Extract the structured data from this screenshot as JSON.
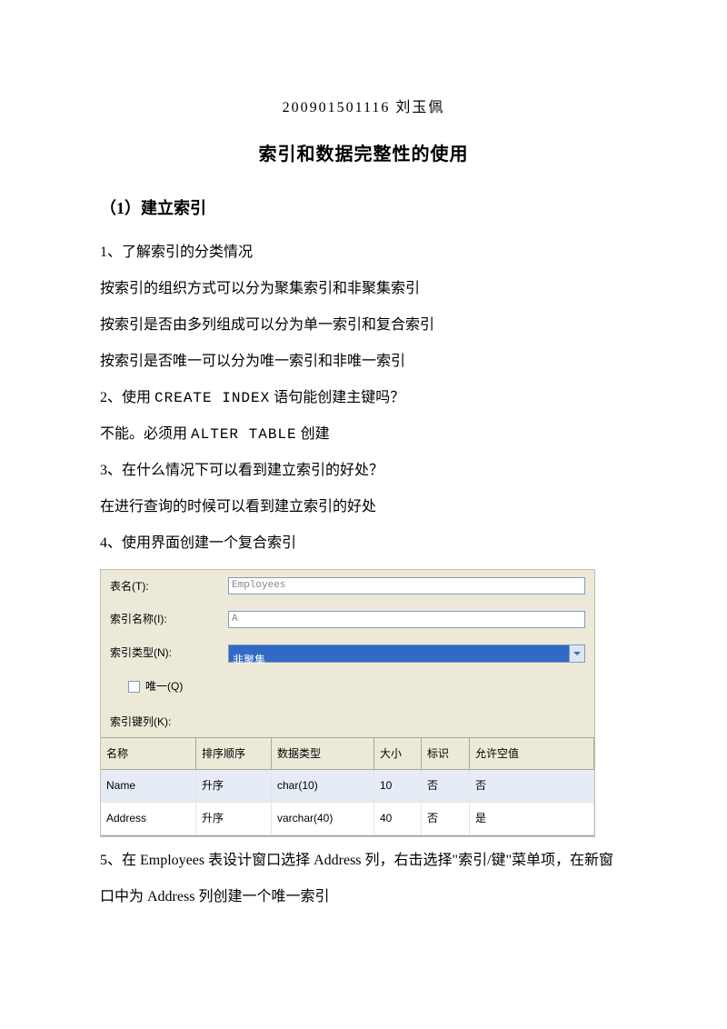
{
  "header": "200901501116 刘玉佩",
  "title": "索引和数据完整性的使用",
  "section1": {
    "heading": "（1）建立索引",
    "p1": "1、了解索引的分类情况",
    "p2": "按索引的组织方式可以分为聚集索引和非聚集索引",
    "p3": "按索引是否由多列组成可以分为单一索引和复合索引",
    "p4": "按索引是否唯一可以分为唯一索引和非唯一索引",
    "p5a": "2、使用 ",
    "p5code": "CREATE INDEX",
    "p5b": " 语句能创建主键吗？",
    "p6a": "不能。必须用 ",
    "p6code": "ALTER TABLE",
    "p6b": " 创建",
    "p7": "3、在什么情况下可以看到建立索引的好处？",
    "p8": "在进行查询的时候可以看到建立索引的好处",
    "p9": "4、使用界面创建一个复合索引",
    "p10": "5、在 Employees 表设计窗口选择 Address 列，右击选择\"索引/键\"菜单项，在新窗口中为 Address 列创建一个唯一索引"
  },
  "form": {
    "labels": {
      "tableName": "表名(T):",
      "indexName": "索引名称(I):",
      "indexType": "索引类型(N):",
      "unique": "唯一(Q)",
      "keyColumns": "索引键列(K):"
    },
    "values": {
      "tableName": "Employees",
      "indexName": "A",
      "indexType": "非聚集"
    },
    "grid": {
      "headers": {
        "name": "名称",
        "sort": "排序顺序",
        "dtype": "数据类型",
        "size": "大小",
        "ident": "标识",
        "nullable": "允许空值"
      },
      "rows": [
        {
          "name": "Name",
          "sort": "升序",
          "dtype": "char(10)",
          "size": "10",
          "ident": "否",
          "nullable": "否",
          "selected": true
        },
        {
          "name": "Address",
          "sort": "升序",
          "dtype": "varchar(40)",
          "size": "40",
          "ident": "否",
          "nullable": "是",
          "selected": false
        }
      ]
    }
  }
}
